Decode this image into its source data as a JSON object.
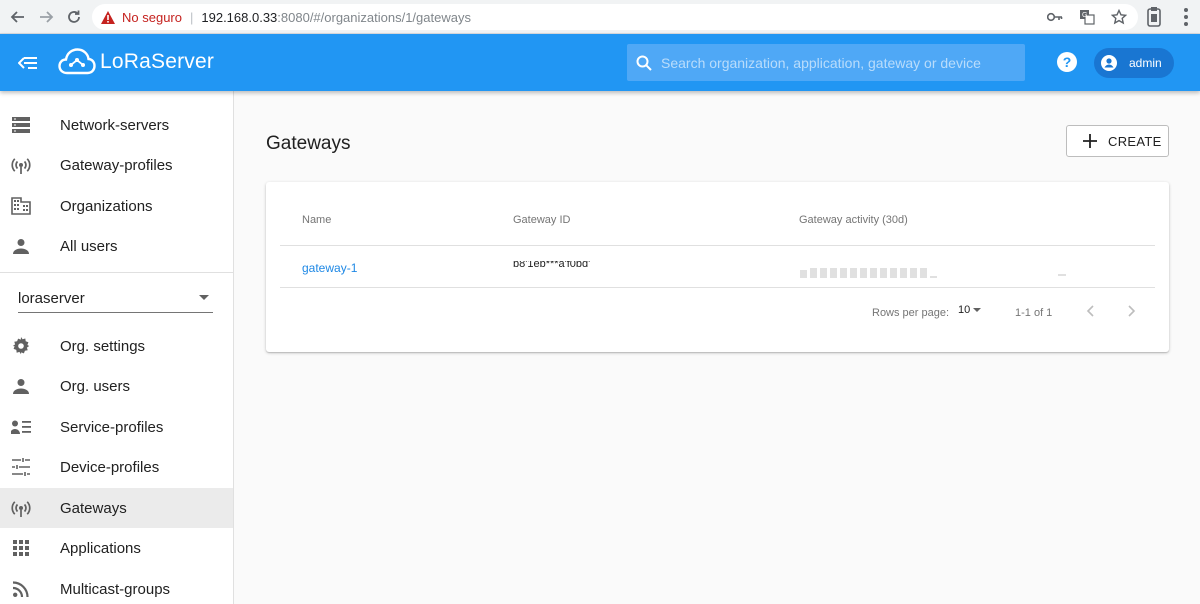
{
  "browser": {
    "not_secure": "No seguro",
    "url_host": "192.168.0.33",
    "url_path": ":8080/#/organizations/1/gateways"
  },
  "header": {
    "logo_text": "LoRaServer",
    "search_placeholder": "Search organization, application, gateway or device",
    "user_name": "admin"
  },
  "sidebar": {
    "global_items": [
      {
        "label": "Network-servers",
        "icon": "server-icon"
      },
      {
        "label": "Gateway-profiles",
        "icon": "radio-tower-icon"
      },
      {
        "label": "Organizations",
        "icon": "domain-icon"
      },
      {
        "label": "All users",
        "icon": "person-icon"
      }
    ],
    "org_select_value": "loraserver",
    "org_items": [
      {
        "label": "Org. settings",
        "icon": "gear-icon"
      },
      {
        "label": "Org. users",
        "icon": "person-icon"
      },
      {
        "label": "Service-profiles",
        "icon": "account-details-icon"
      },
      {
        "label": "Device-profiles",
        "icon": "tune-icon"
      },
      {
        "label": "Gateways",
        "icon": "radio-tower-icon",
        "active": true
      },
      {
        "label": "Applications",
        "icon": "apps-grid-icon"
      },
      {
        "label": "Multicast-groups",
        "icon": "rss-icon"
      }
    ]
  },
  "main": {
    "title": "Gateways",
    "create_label": "CREATE",
    "table": {
      "columns": [
        "Name",
        "Gateway ID",
        "Gateway activity (30d)"
      ],
      "rows": [
        {
          "name": "gateway-1",
          "gateway_id": "b8'1eb***a'f0bd'"
        }
      ]
    },
    "pagination": {
      "rows_per_page_label": "Rows per page:",
      "rows_per_page_value": "10",
      "range": "1-1 of 1"
    }
  },
  "colors": {
    "header": "#2196f3",
    "link": "#1e88e5",
    "active_item": "#ebebeb"
  }
}
